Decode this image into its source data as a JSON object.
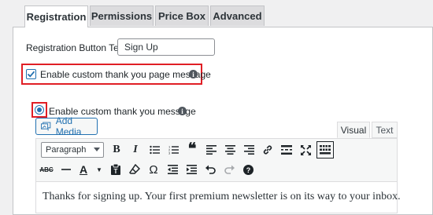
{
  "tabs": [
    {
      "label": "Registration",
      "active": true
    },
    {
      "label": "Permissions",
      "active": false
    },
    {
      "label": "Price Box",
      "active": false
    },
    {
      "label": "Advanced",
      "active": false
    }
  ],
  "registration_button": {
    "label": "Registration Button Text:",
    "value": "Sign Up"
  },
  "thank_you_page": {
    "label": "Enable custom thank you page message",
    "checked": true
  },
  "thank_you_message": {
    "label": "Enable custom thank you message",
    "selected": true
  },
  "editor": {
    "add_media_label": "Add Media",
    "tabs": [
      "Visual",
      "Text"
    ],
    "format_select": "Paragraph",
    "toolbar_row1": [
      "bold-icon",
      "italic-icon",
      "bulleted-list-icon",
      "numbered-list-icon",
      "blockquote-icon",
      "align-left-icon",
      "align-center-icon",
      "align-right-icon",
      "link-icon",
      "read-more-icon",
      "fullscreen-icon",
      "toolbar-toggle-icon"
    ],
    "toolbar_row2": [
      "strikethrough-icon",
      "horizontal-line-icon",
      "text-color-icon",
      "paste-text-icon",
      "clear-formatting-icon",
      "special-character-icon",
      "decrease-indent-icon",
      "increase-indent-icon",
      "undo-icon",
      "redo-icon",
      "help-icon"
    ],
    "content": "Thanks for signing up. Your first premium newsletter is on its way to your inbox."
  },
  "colors": {
    "accent": "#2271b1",
    "highlight": "#e01e25"
  }
}
